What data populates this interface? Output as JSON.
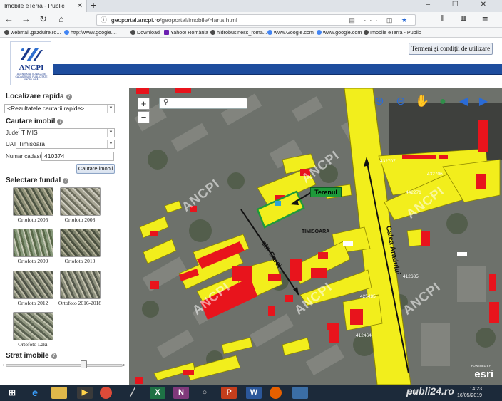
{
  "browser": {
    "tab_title": "Imobile eTerra - Public",
    "url_domain": "geoportal.ancpi.ro",
    "url_path": "/geoportal/imobile/Harta.html",
    "bookmarks": [
      "webmail.gazduire.ro...",
      "http://www.google....",
      "Download",
      "Yahoo! România",
      "hidrobusiness_roma...",
      "www.Google.com",
      "www.google.com",
      "Imobile eTerra - Public"
    ]
  },
  "header": {
    "logo_text": "ANCPI",
    "logo_sub": "AGENŢIA NAŢIONALĂ DE CADASTRU ŞI PUBLICITATE IMOBILIARĂ",
    "termeni_button": "Termeni şi condiţii de utilizare"
  },
  "left_panel": {
    "localizare_title": "Localizare rapida",
    "rapid_search_value": "<Rezultatele cautarii rapide>",
    "cautare_title": "Cautare imobil",
    "judet_label": "Judet",
    "judet_value": "TIMIS",
    "uat_label": "UAT",
    "uat_value": "Timisoara",
    "cadastral_label": "Numar cadastral",
    "cadastral_value": "410374",
    "cautare_button": "Cautare imobil",
    "fundal_title": "Selectare fundal",
    "fundal_items": [
      "Ortofoto 2005",
      "Ortofoto 2008",
      "Ortofoto 2009",
      "Ortofoto 2010",
      "Ortofoto 2012",
      "Ortofoto 2016-2018",
      "Ortofoto Laki"
    ],
    "strat_title": "Strat imobile",
    "strat_opacity": 0.66
  },
  "map": {
    "watermark": "ANCPI",
    "terenul_label": "Terenul",
    "timisoara_label": "TIMISOARA",
    "street_carei": "str. Carei",
    "street_aradului": "Calea Aradului",
    "parcel_labels": [
      "432707",
      "432706",
      "442271",
      "412685",
      "425485",
      "412464"
    ],
    "zoom_in": "+",
    "zoom_out": "−",
    "esri_text": "esri",
    "esri_powered": "POWERED BY"
  },
  "taskbar": {
    "lang": "EN",
    "time": "14:23",
    "date": "16/05/2019",
    "watermark": "publi24.ro"
  },
  "colors": {
    "parcel_yellow": "#f2ee1c",
    "building_red": "#e8141c",
    "header_blue": "#1e4d9e",
    "terenul_green": "#1e9a3a"
  }
}
